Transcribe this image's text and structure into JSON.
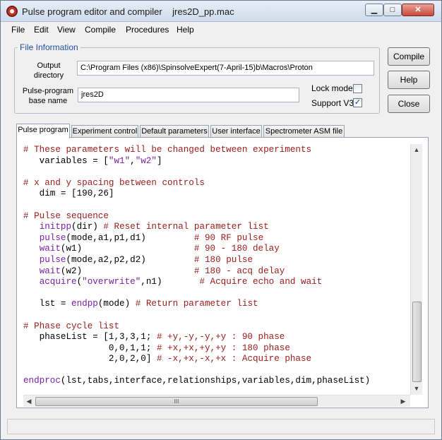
{
  "window": {
    "title": "Pulse program editor and compiler    jres2D_pp.mac",
    "minimize_glyph": "▁",
    "maximize_glyph": "□",
    "close_glyph": "✕"
  },
  "menu": [
    "File",
    "Edit",
    "View",
    "Compile",
    "Procedures",
    "Help"
  ],
  "file_info": {
    "group_title": "File Information",
    "output_label_1": "Output",
    "output_label_2": "directory",
    "output_value": "C:\\Program Files (x86)\\SpinsolveExpert(7-April-15)b\\Macros\\Proton",
    "basename_label_1": "Pulse-program",
    "basename_label_2": "base name",
    "basename_value": "jres2D",
    "lock_label": "Lock mode:",
    "lock_checked": false,
    "support_label": "Support V3:",
    "support_checked": true,
    "check_glyph": "✓"
  },
  "buttons": {
    "compile": "Compile",
    "help": "Help",
    "close": "Close"
  },
  "tabs": [
    "Pulse program",
    "Experiment control",
    "Default parameters",
    "User interface",
    "Spectrometer ASM file"
  ],
  "active_tab": 0,
  "code": [
    [
      {
        "t": "# These parameters will be changed between experiments",
        "c": "comment"
      }
    ],
    [
      {
        "t": "   variables = [",
        "c": "plain"
      },
      {
        "t": "\"w1\"",
        "c": "str"
      },
      {
        "t": ",",
        "c": "plain"
      },
      {
        "t": "\"w2\"",
        "c": "str"
      },
      {
        "t": "]",
        "c": "plain"
      }
    ],
    [
      {
        "t": "",
        "c": "plain"
      }
    ],
    [
      {
        "t": "# x and y spacing between controls",
        "c": "comment"
      }
    ],
    [
      {
        "t": "   dim = [190,26]",
        "c": "plain"
      }
    ],
    [
      {
        "t": "",
        "c": "plain"
      }
    ],
    [
      {
        "t": "# Pulse sequence",
        "c": "comment"
      }
    ],
    [
      {
        "t": "   ",
        "c": "plain"
      },
      {
        "t": "initpp",
        "c": "func"
      },
      {
        "t": "(dir) ",
        "c": "plain"
      },
      {
        "t": "# Reset internal parameter list",
        "c": "comment"
      }
    ],
    [
      {
        "t": "   ",
        "c": "plain"
      },
      {
        "t": "pulse",
        "c": "func"
      },
      {
        "t": "(mode,a1,p1,d1)         ",
        "c": "plain"
      },
      {
        "t": "# 90 RF pulse",
        "c": "comment"
      }
    ],
    [
      {
        "t": "   ",
        "c": "plain"
      },
      {
        "t": "wait",
        "c": "func"
      },
      {
        "t": "(w1)                     ",
        "c": "plain"
      },
      {
        "t": "# 90 - 180 delay",
        "c": "comment"
      }
    ],
    [
      {
        "t": "   ",
        "c": "plain"
      },
      {
        "t": "pulse",
        "c": "func"
      },
      {
        "t": "(mode,a2,p2,d2)         ",
        "c": "plain"
      },
      {
        "t": "# 180 pulse",
        "c": "comment"
      }
    ],
    [
      {
        "t": "   ",
        "c": "plain"
      },
      {
        "t": "wait",
        "c": "func"
      },
      {
        "t": "(w2)                     ",
        "c": "plain"
      },
      {
        "t": "# 180 - acq delay",
        "c": "comment"
      }
    ],
    [
      {
        "t": "   ",
        "c": "plain"
      },
      {
        "t": "acquire",
        "c": "func"
      },
      {
        "t": "(",
        "c": "plain"
      },
      {
        "t": "\"overwrite\"",
        "c": "str"
      },
      {
        "t": ",n1)       ",
        "c": "plain"
      },
      {
        "t": "# Acquire echo and wait",
        "c": "comment"
      }
    ],
    [
      {
        "t": "",
        "c": "plain"
      }
    ],
    [
      {
        "t": "   lst = ",
        "c": "plain"
      },
      {
        "t": "endpp",
        "c": "func"
      },
      {
        "t": "(mode) ",
        "c": "plain"
      },
      {
        "t": "# Return parameter list",
        "c": "comment"
      }
    ],
    [
      {
        "t": "",
        "c": "plain"
      }
    ],
    [
      {
        "t": "# Phase cycle list",
        "c": "comment"
      }
    ],
    [
      {
        "t": "   phaseList = [1,3,3,1; ",
        "c": "plain"
      },
      {
        "t": "# +y,-y,-y,+y : 90 phase",
        "c": "comment"
      }
    ],
    [
      {
        "t": "                0,0,1,1; ",
        "c": "plain"
      },
      {
        "t": "# +x,+x,+y,+y : 180 phase",
        "c": "comment"
      }
    ],
    [
      {
        "t": "                2,0,2,0] ",
        "c": "plain"
      },
      {
        "t": "# -x,+x,-x,+x : Acquire phase",
        "c": "comment"
      }
    ],
    [
      {
        "t": "",
        "c": "plain"
      }
    ],
    [
      {
        "t": "endproc",
        "c": "func"
      },
      {
        "t": "(lst,tabs,interface,relationships,variables,dim,phaseList)",
        "c": "plain"
      }
    ]
  ],
  "scrollbars": {
    "up_glyph": "▲",
    "down_glyph": "▼",
    "left_glyph": "◀",
    "right_glyph": "▶",
    "grip_glyph": "III"
  },
  "colors": {
    "comment": "#9a1b1b",
    "function": "#7a1fa8",
    "string": "#7a1fa8",
    "group_title": "#1f4f9c"
  }
}
